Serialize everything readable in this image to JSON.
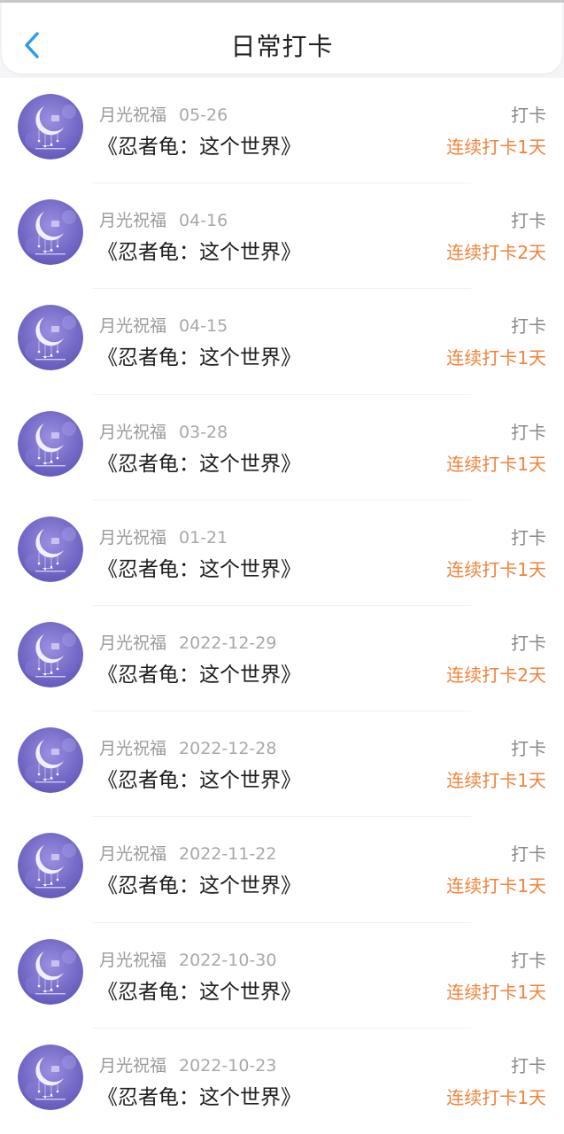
{
  "header": {
    "title": "日常打卡",
    "back_icon": "chevron-left-icon",
    "accent": "#2f9be8"
  },
  "colors": {
    "streak": "#f2823a",
    "avatar_bg": "#6f66c4"
  },
  "items": [
    {
      "user": "月光祝福",
      "date": "05-26",
      "title": "《忍者龟：这个世界》",
      "action": "打卡",
      "streak": "连续打卡1天"
    },
    {
      "user": "月光祝福",
      "date": "04-16",
      "title": "《忍者龟：这个世界》",
      "action": "打卡",
      "streak": "连续打卡2天"
    },
    {
      "user": "月光祝福",
      "date": "04-15",
      "title": "《忍者龟：这个世界》",
      "action": "打卡",
      "streak": "连续打卡1天"
    },
    {
      "user": "月光祝福",
      "date": "03-28",
      "title": "《忍者龟：这个世界》",
      "action": "打卡",
      "streak": "连续打卡1天"
    },
    {
      "user": "月光祝福",
      "date": "01-21",
      "title": "《忍者龟：这个世界》",
      "action": "打卡",
      "streak": "连续打卡1天"
    },
    {
      "user": "月光祝福",
      "date": "2022-12-29",
      "title": "《忍者龟：这个世界》",
      "action": "打卡",
      "streak": "连续打卡2天"
    },
    {
      "user": "月光祝福",
      "date": "2022-12-28",
      "title": "《忍者龟：这个世界》",
      "action": "打卡",
      "streak": "连续打卡1天"
    },
    {
      "user": "月光祝福",
      "date": "2022-11-22",
      "title": "《忍者龟：这个世界》",
      "action": "打卡",
      "streak": "连续打卡1天"
    },
    {
      "user": "月光祝福",
      "date": "2022-10-30",
      "title": "《忍者龟：这个世界》",
      "action": "打卡",
      "streak": "连续打卡1天"
    },
    {
      "user": "月光祝福",
      "date": "2022-10-23",
      "title": "《忍者龟：这个世界》",
      "action": "打卡",
      "streak": "连续打卡1天"
    }
  ]
}
